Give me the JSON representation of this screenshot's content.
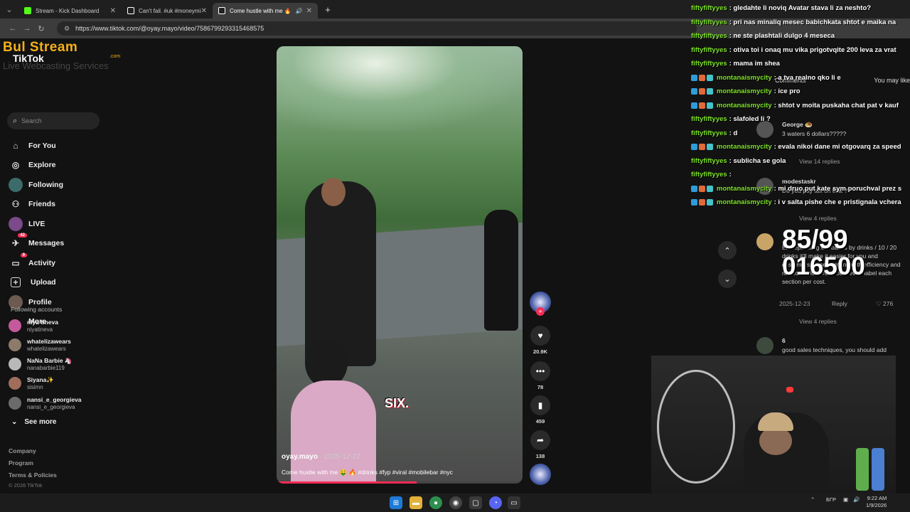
{
  "browser": {
    "tabs": [
      {
        "title": "Stream - Kick Dashboard",
        "color": "#53fc18",
        "active": false
      },
      {
        "title": "Can't fail. #uk #moneymindset",
        "color": "#ffffff",
        "active": false
      },
      {
        "title": "Come hustle with me 🔥",
        "color": "#ffffff",
        "active": true
      }
    ],
    "url": "https://www.tiktok.com/@oyay.mayo/video/7586799293315468575"
  },
  "logo": {
    "main": "Bul Stream",
    "tiktok": "TikTok",
    "sub": "Live Webcasting Services",
    "com": ".com"
  },
  "search": {
    "placeholder": "Search"
  },
  "menu": [
    {
      "label": "For You",
      "icon": "home-icon",
      "glyph": "⌂"
    },
    {
      "label": "Explore",
      "icon": "compass-icon",
      "glyph": "◎"
    },
    {
      "label": "Following",
      "icon": "following-avatar-icon",
      "glyph": ""
    },
    {
      "label": "Friends",
      "icon": "friends-icon",
      "glyph": "⚇"
    },
    {
      "label": "LIVE",
      "icon": "live-avatar-icon",
      "glyph": ""
    },
    {
      "label": "Messages",
      "icon": "messages-icon",
      "glyph": "✈",
      "badge": "42"
    },
    {
      "label": "Activity",
      "icon": "activity-icon",
      "glyph": "▭",
      "badge": "9"
    },
    {
      "label": "Upload",
      "icon": "upload-icon",
      "glyph": "+"
    },
    {
      "label": "Profile",
      "icon": "profile-avatar-icon",
      "glyph": ""
    },
    {
      "label": "More",
      "icon": "more-icon",
      "glyph": "···"
    }
  ],
  "following": {
    "heading": "Following accounts",
    "accounts": [
      {
        "name": "niya tineva",
        "handle": "niyatineva",
        "color": "#c45a9b"
      },
      {
        "name": "whatelizawears",
        "handle": "whatelizawears",
        "color": "#8c7b6a"
      },
      {
        "name": "NaNa Barbie 🦄",
        "handle": "nanabarbie119",
        "color": "#b9b9b9"
      },
      {
        "name": "Siyana✨",
        "handle": "sisimn",
        "color": "#a06d5d"
      },
      {
        "name": "nansi_e_georgieva",
        "handle": "nansi_e_georgieva",
        "color": "#6b6b6b"
      }
    ],
    "see_more": "See more"
  },
  "footer": {
    "company": "Company",
    "program": "Program",
    "terms": "Terms & Policies",
    "copyright": "© 2026 TikTok"
  },
  "video": {
    "overlay_text": "SIX.",
    "username": "oyay.mayo",
    "date": "· 2025-12-22",
    "description": "Come hustle with me 🤑 🔥 #drinks #fyp #viral #mobilebar #nyc",
    "progress": 0.57
  },
  "actions": {
    "likes": "20.9K",
    "comments": "78",
    "saves": "459",
    "shares": "138"
  },
  "chat": [
    {
      "user": "fiftyfiftyyes",
      "text": ": gledahte li noviq Avatar stava li za neshto?",
      "badges": false
    },
    {
      "user": "fiftyfiftyyes",
      "text": ": pri nas minaliq mesec babichkata shtot e maika na",
      "badges": false
    },
    {
      "user": "fiftyfiftyyes",
      "text": ": ne ste plashtali dulgo 4 meseca",
      "badges": false
    },
    {
      "user": "fiftyfiftyyes",
      "text": ": otiva toi i onaq mu vika prigotvqite 200 leva za vrat",
      "badges": false
    },
    {
      "user": "fiftyfiftyyes",
      "text": ": mama im shea",
      "badges": false
    },
    {
      "user": "montanaismycity",
      "text": ": a tva realno qko li e",
      "badges": true
    },
    {
      "user": "montanaismycity",
      "text": ": ice pro",
      "badges": true
    },
    {
      "user": "montanaismycity",
      "text": ": shtot v moita puskaha chat pat v kauf",
      "badges": true
    },
    {
      "user": "fiftyfiftyyes",
      "text": ": slafoled li ?",
      "badges": false
    },
    {
      "user": "fiftyfiftyyes",
      "text": ": d",
      "badges": false
    },
    {
      "user": "montanaismycity",
      "text": ": evala nikoi dane mi otgovarq za speed",
      "badges": true
    },
    {
      "user": "fiftyfiftyyes",
      "text": ": sublicha se gola",
      "badges": false
    },
    {
      "user": "fiftyfiftyyes",
      "text": ": ",
      "badges": false
    },
    {
      "user": "montanaismycity",
      "text": ": mi druo put kate sym poruchval prez s",
      "badges": true
    },
    {
      "user": "montanaismycity",
      "text": ": i v salta pishe che e pristignala vchera",
      "badges": true
    }
  ],
  "comments_panel": {
    "tab_comments": "Comments",
    "tab_you_may_like": "You may like",
    "items": [
      {
        "name": "George 🧆",
        "text": "3 waters 6 dollars?????"
      },
      {
        "name": "modestaskr",
        "text": "Do you pay tax on that ?"
      },
      {
        "name": "",
        "text": "Eh separating the bases by drinks / 10 / 20 drinks it'll make it easier for you and customers so set a menu with efficiency and not confusion. You could even label each section per cost."
      },
      {
        "name": "6",
        "text": "good sales techniques, you should add"
      }
    ],
    "view_replies_1": "View 14 replies",
    "view_replies_2": "View 4 replies",
    "view_replies_3": "View 4 replies",
    "comment_date": "2025-12-23",
    "reply": "Reply",
    "comment_likes": "276"
  },
  "stream_counter": {
    "top": "85/99",
    "bottom": "016500"
  },
  "taskbar": {
    "lang": "БГР",
    "time": "9:22 AM",
    "date": "1/9/2026"
  }
}
